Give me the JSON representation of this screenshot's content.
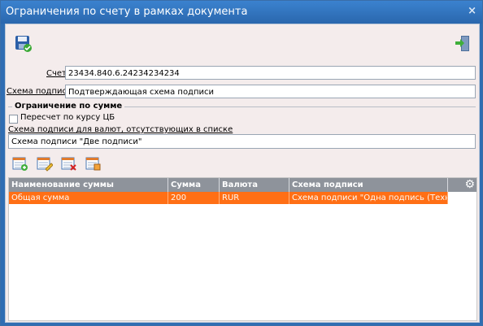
{
  "window": {
    "title": "Ограничения по счету в рамках документа",
    "close_glyph": "×"
  },
  "toolbar": {
    "save_icon": "save-icon",
    "exit_icon": "exit-door-icon"
  },
  "account": {
    "label": "Счет",
    "value": "23434.840.6.24234234234"
  },
  "scheme": {
    "label": "Схема подписи",
    "value": "Подтверждающая схема подписи"
  },
  "sum_limit": {
    "title": "Ограничение по сумме",
    "recalc_label": "Пересчет по курсу ЦБ",
    "recalc_checked": false,
    "missing_currency_label": "Схема подписи для валют, отсутствующих в списке",
    "missing_currency_value": "Схема подписи \"Две подписи\""
  },
  "grid_actions": [
    "add-row-icon",
    "edit-row-icon",
    "delete-row-icon",
    "copy-row-icon"
  ],
  "grid": {
    "columns": [
      "Наименование суммы",
      "Сумма",
      "Валюта",
      "Схема подписи"
    ],
    "rows": [
      [
        "Общая сумма",
        "200",
        "RUR",
        "Схема подписи \"Одна подпись (Техн.)\""
      ]
    ]
  },
  "colors": {
    "title_bar": "#2f6db3",
    "selected_row": "#ff6f15",
    "header": "#8e939b"
  }
}
